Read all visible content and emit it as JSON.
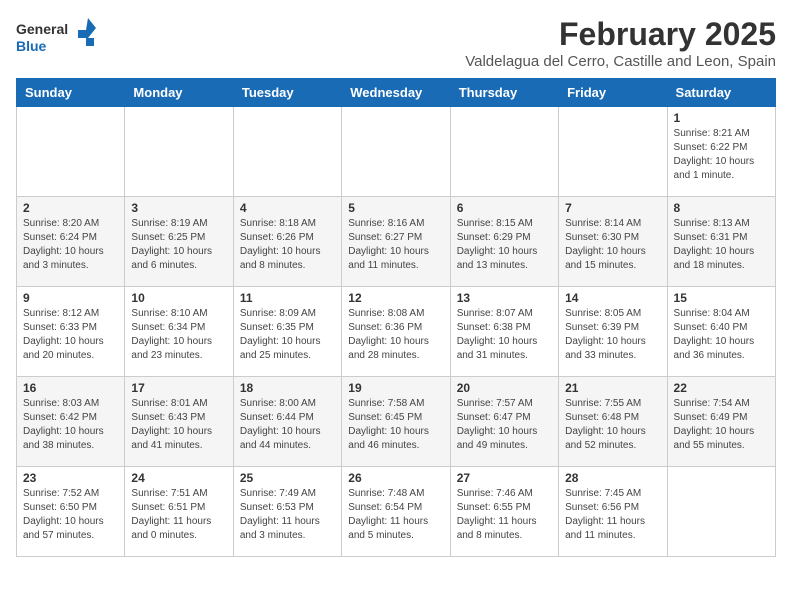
{
  "header": {
    "logo_general": "General",
    "logo_blue": "Blue",
    "title": "February 2025",
    "subtitle": "Valdelagua del Cerro, Castille and Leon, Spain"
  },
  "days_of_week": [
    "Sunday",
    "Monday",
    "Tuesday",
    "Wednesday",
    "Thursday",
    "Friday",
    "Saturday"
  ],
  "weeks": [
    [
      {
        "day": "",
        "info": ""
      },
      {
        "day": "",
        "info": ""
      },
      {
        "day": "",
        "info": ""
      },
      {
        "day": "",
        "info": ""
      },
      {
        "day": "",
        "info": ""
      },
      {
        "day": "",
        "info": ""
      },
      {
        "day": "1",
        "info": "Sunrise: 8:21 AM\nSunset: 6:22 PM\nDaylight: 10 hours and 1 minute."
      }
    ],
    [
      {
        "day": "2",
        "info": "Sunrise: 8:20 AM\nSunset: 6:24 PM\nDaylight: 10 hours and 3 minutes."
      },
      {
        "day": "3",
        "info": "Sunrise: 8:19 AM\nSunset: 6:25 PM\nDaylight: 10 hours and 6 minutes."
      },
      {
        "day": "4",
        "info": "Sunrise: 8:18 AM\nSunset: 6:26 PM\nDaylight: 10 hours and 8 minutes."
      },
      {
        "day": "5",
        "info": "Sunrise: 8:16 AM\nSunset: 6:27 PM\nDaylight: 10 hours and 11 minutes."
      },
      {
        "day": "6",
        "info": "Sunrise: 8:15 AM\nSunset: 6:29 PM\nDaylight: 10 hours and 13 minutes."
      },
      {
        "day": "7",
        "info": "Sunrise: 8:14 AM\nSunset: 6:30 PM\nDaylight: 10 hours and 15 minutes."
      },
      {
        "day": "8",
        "info": "Sunrise: 8:13 AM\nSunset: 6:31 PM\nDaylight: 10 hours and 18 minutes."
      }
    ],
    [
      {
        "day": "9",
        "info": "Sunrise: 8:12 AM\nSunset: 6:33 PM\nDaylight: 10 hours and 20 minutes."
      },
      {
        "day": "10",
        "info": "Sunrise: 8:10 AM\nSunset: 6:34 PM\nDaylight: 10 hours and 23 minutes."
      },
      {
        "day": "11",
        "info": "Sunrise: 8:09 AM\nSunset: 6:35 PM\nDaylight: 10 hours and 25 minutes."
      },
      {
        "day": "12",
        "info": "Sunrise: 8:08 AM\nSunset: 6:36 PM\nDaylight: 10 hours and 28 minutes."
      },
      {
        "day": "13",
        "info": "Sunrise: 8:07 AM\nSunset: 6:38 PM\nDaylight: 10 hours and 31 minutes."
      },
      {
        "day": "14",
        "info": "Sunrise: 8:05 AM\nSunset: 6:39 PM\nDaylight: 10 hours and 33 minutes."
      },
      {
        "day": "15",
        "info": "Sunrise: 8:04 AM\nSunset: 6:40 PM\nDaylight: 10 hours and 36 minutes."
      }
    ],
    [
      {
        "day": "16",
        "info": "Sunrise: 8:03 AM\nSunset: 6:42 PM\nDaylight: 10 hours and 38 minutes."
      },
      {
        "day": "17",
        "info": "Sunrise: 8:01 AM\nSunset: 6:43 PM\nDaylight: 10 hours and 41 minutes."
      },
      {
        "day": "18",
        "info": "Sunrise: 8:00 AM\nSunset: 6:44 PM\nDaylight: 10 hours and 44 minutes."
      },
      {
        "day": "19",
        "info": "Sunrise: 7:58 AM\nSunset: 6:45 PM\nDaylight: 10 hours and 46 minutes."
      },
      {
        "day": "20",
        "info": "Sunrise: 7:57 AM\nSunset: 6:47 PM\nDaylight: 10 hours and 49 minutes."
      },
      {
        "day": "21",
        "info": "Sunrise: 7:55 AM\nSunset: 6:48 PM\nDaylight: 10 hours and 52 minutes."
      },
      {
        "day": "22",
        "info": "Sunrise: 7:54 AM\nSunset: 6:49 PM\nDaylight: 10 hours and 55 minutes."
      }
    ],
    [
      {
        "day": "23",
        "info": "Sunrise: 7:52 AM\nSunset: 6:50 PM\nDaylight: 10 hours and 57 minutes."
      },
      {
        "day": "24",
        "info": "Sunrise: 7:51 AM\nSunset: 6:51 PM\nDaylight: 11 hours and 0 minutes."
      },
      {
        "day": "25",
        "info": "Sunrise: 7:49 AM\nSunset: 6:53 PM\nDaylight: 11 hours and 3 minutes."
      },
      {
        "day": "26",
        "info": "Sunrise: 7:48 AM\nSunset: 6:54 PM\nDaylight: 11 hours and 5 minutes."
      },
      {
        "day": "27",
        "info": "Sunrise: 7:46 AM\nSunset: 6:55 PM\nDaylight: 11 hours and 8 minutes."
      },
      {
        "day": "28",
        "info": "Sunrise: 7:45 AM\nSunset: 6:56 PM\nDaylight: 11 hours and 11 minutes."
      },
      {
        "day": "",
        "info": ""
      }
    ]
  ]
}
